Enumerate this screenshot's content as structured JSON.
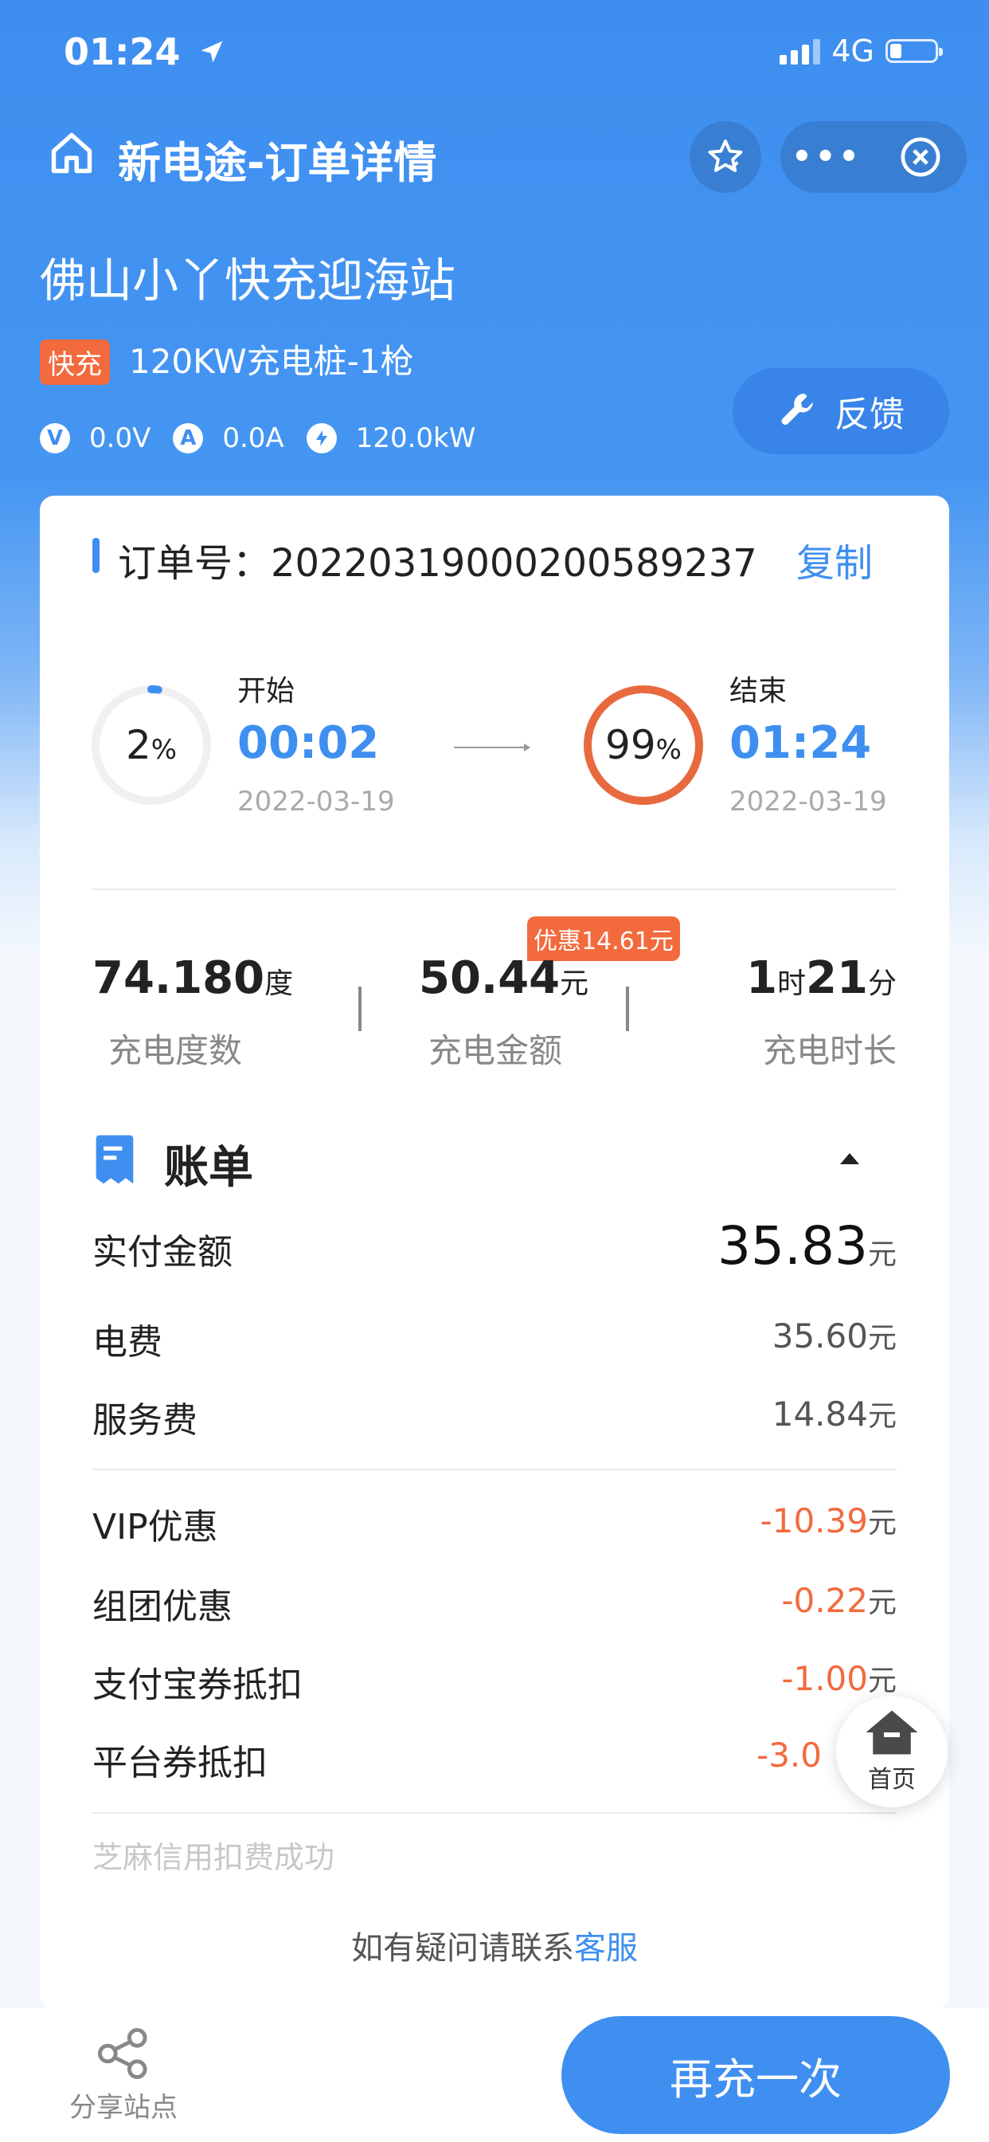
{
  "status_bar": {
    "time": "01:24",
    "network": "4G"
  },
  "nav": {
    "title": "新电途-订单详情",
    "more_label": "•••"
  },
  "station": {
    "name": "佛山小丫快充迎海站",
    "tag": "快充",
    "pile": "120KW充电桩-1枪",
    "voltage_icon": "V",
    "voltage": "0.0V",
    "current_icon": "A",
    "current": "0.0A",
    "power": "120.0kW",
    "feedback_label": "反馈"
  },
  "order": {
    "label": "订单号：",
    "number": "2022031900020058923 7",
    "copy_label": "复制"
  },
  "charge": {
    "start": {
      "soc": 2,
      "soc_text": "2",
      "label": "开始",
      "time": "00:02",
      "date": "2022-03-19"
    },
    "end": {
      "soc": 99,
      "soc_text": "99",
      "label": "结束",
      "time": "01:24",
      "date": "2022-03-19"
    },
    "percent_unit": "%"
  },
  "stats": {
    "energy": {
      "value": "74.180",
      "unit": "度",
      "label": "充电度数"
    },
    "amount": {
      "value": "50.44",
      "unit": "元",
      "label": "充电金额",
      "discount": "优惠14.61元"
    },
    "duration": {
      "hours": "1",
      "hour_unit": "时",
      "minutes": "21",
      "minute_unit": "分",
      "label": "充电时长"
    }
  },
  "bill": {
    "title": "账单",
    "yuan": "元",
    "paid": {
      "label": "实付金额",
      "value": "35.83"
    },
    "items": [
      {
        "label": "电费",
        "value": "35.60"
      },
      {
        "label": "服务费",
        "value": "14.84"
      }
    ],
    "discounts": [
      {
        "label": "VIP优惠",
        "value": "-10.39"
      },
      {
        "label": "组团优惠",
        "value": "-0.22"
      },
      {
        "label": "支付宝券抵扣",
        "value": "-1.00"
      },
      {
        "label": "平台券抵扣",
        "value": "-3.0"
      }
    ],
    "credit_note": "芝麻信用扣费成功",
    "contact_prefix": "如有疑问请联系",
    "contact_link": "客服"
  },
  "float_home_label": "首页",
  "bottom": {
    "share_label": "分享站点",
    "recharge_label": "再充一次"
  },
  "colors": {
    "primary": "#3f8ff0",
    "accent": "#f26a3d"
  }
}
